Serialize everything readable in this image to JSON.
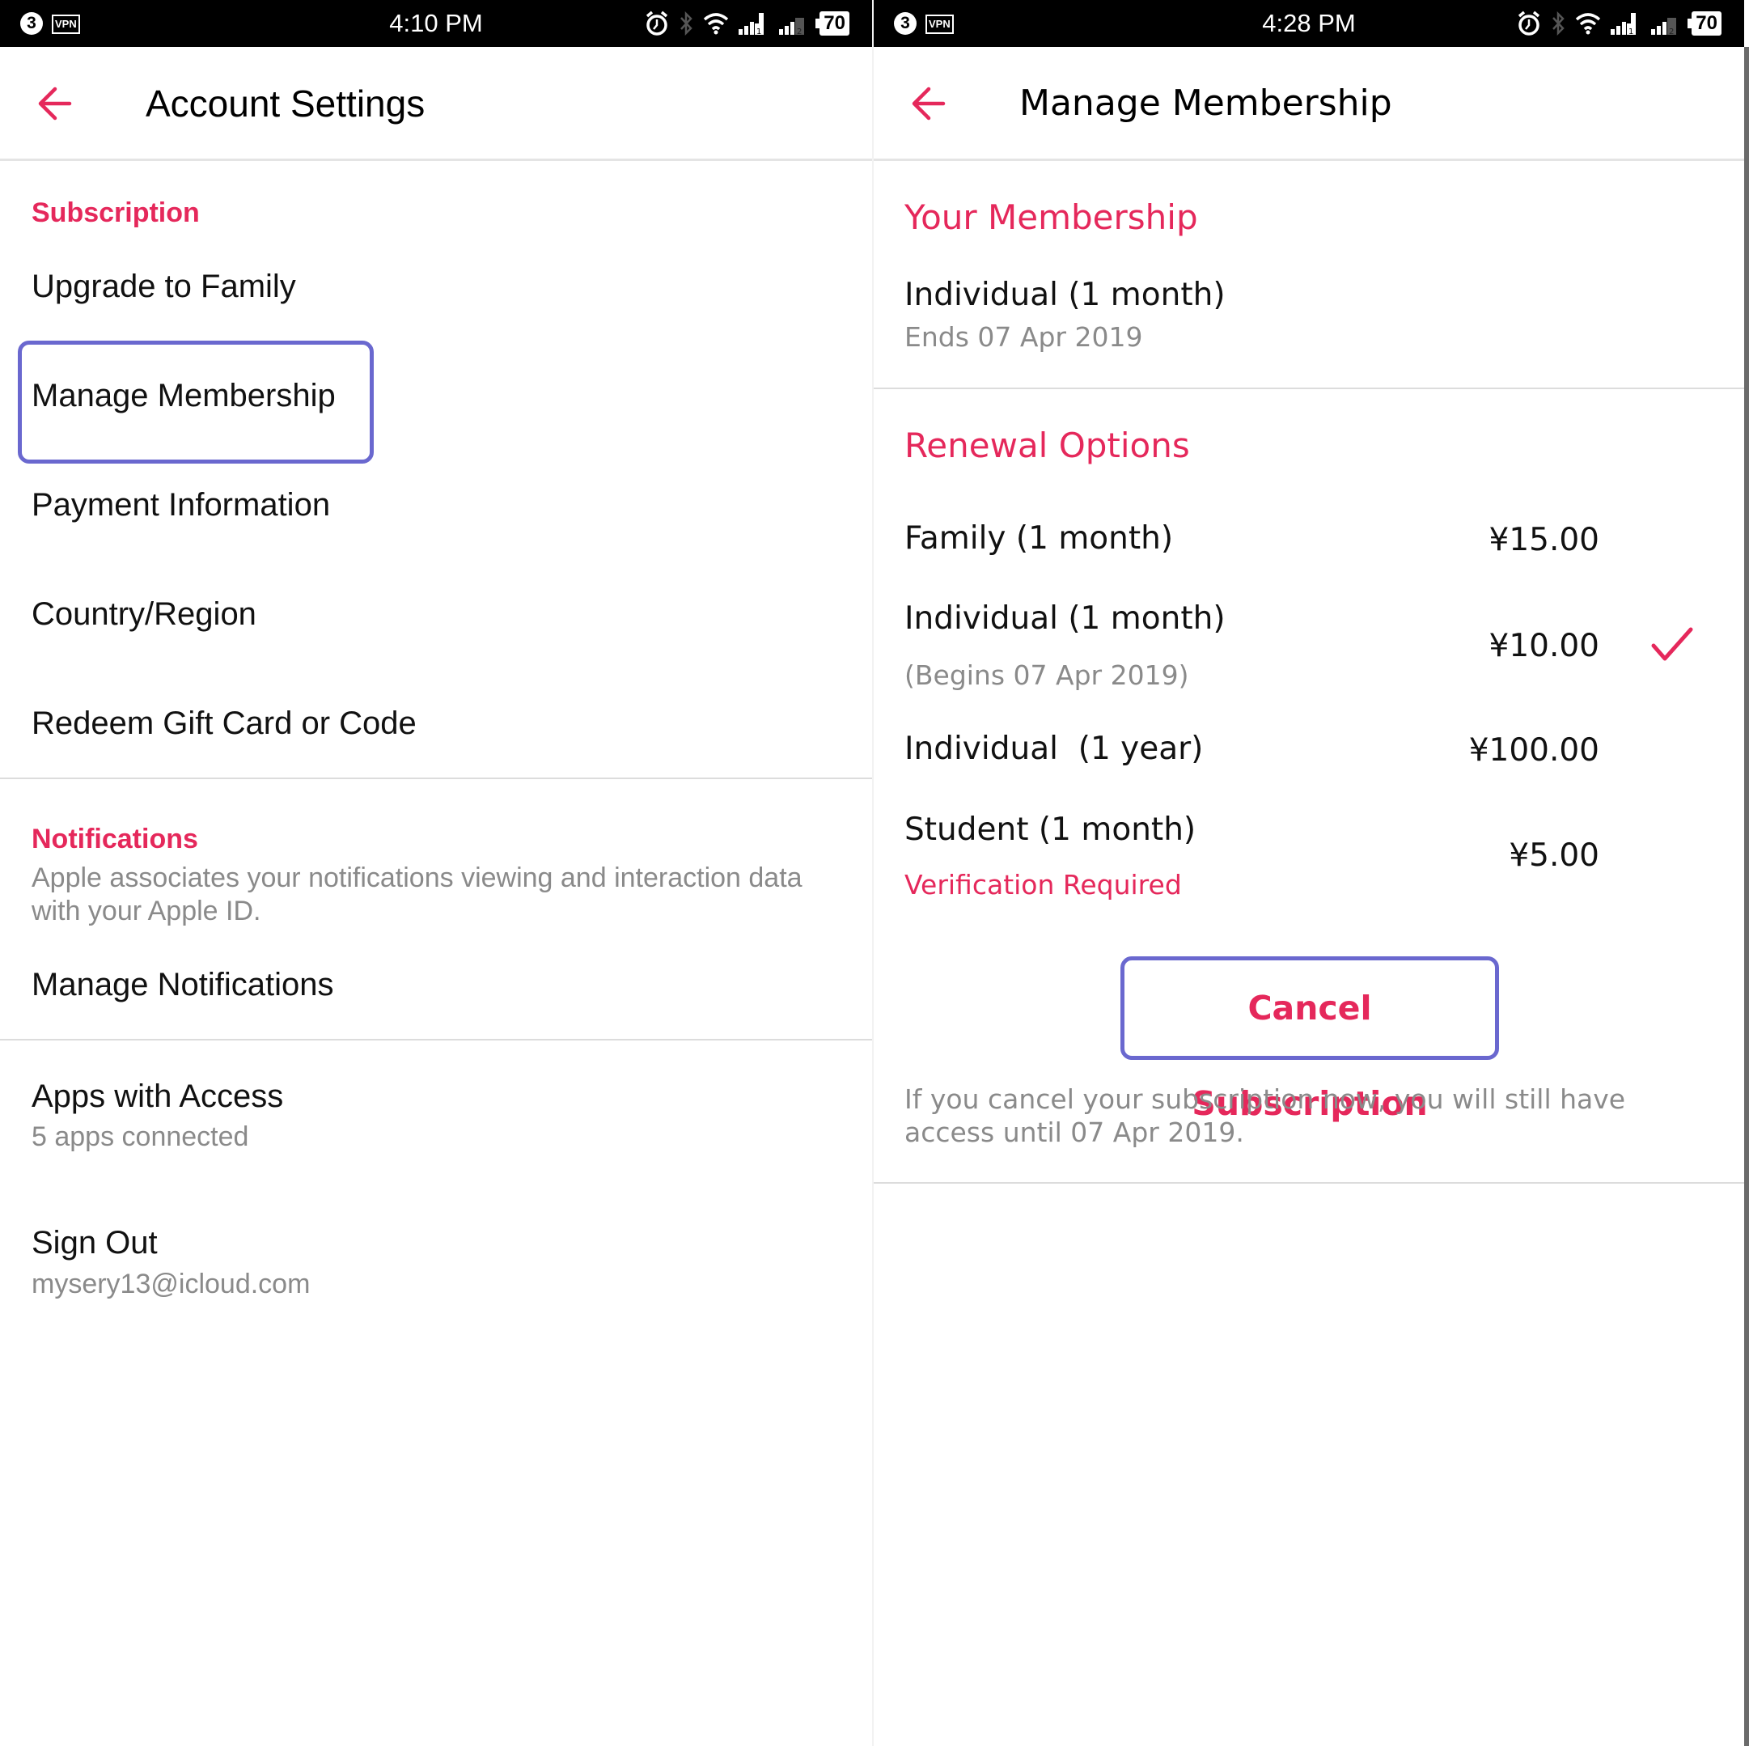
{
  "left_screen": {
    "status_bar": {
      "notification_count": "3",
      "vpn_label": "VPN",
      "time": "4:10 PM",
      "sim1_label": "1",
      "sim2_label": "2",
      "battery": "70"
    },
    "header": {
      "back_icon": "arrow-left-icon",
      "title": "Account Settings"
    },
    "subscription": {
      "heading": "Subscription",
      "items": [
        {
          "label": "Upgrade to Family"
        },
        {
          "label": "Manage Membership",
          "highlighted": true
        },
        {
          "label": "Payment Information"
        },
        {
          "label": "Country/Region"
        },
        {
          "label": "Redeem Gift Card or Code"
        }
      ]
    },
    "notifications": {
      "heading": "Notifications",
      "description_line1": "Apple associates your notifications viewing and interaction data",
      "description_line2": "with your Apple ID.",
      "manage_label": "Manage Notifications"
    },
    "apps_with_access": {
      "label": "Apps with Access",
      "subtitle": "5 apps connected"
    },
    "sign_out": {
      "label": "Sign Out",
      "email": "mysery13@icloud.com"
    }
  },
  "right_screen": {
    "status_bar": {
      "notification_count": "3",
      "vpn_label": "VPN",
      "time": "4:28 PM",
      "sim1_label": "1",
      "sim2_label": "2",
      "battery": "70"
    },
    "header": {
      "back_icon": "arrow-left-icon",
      "title": "Manage Membership"
    },
    "your_membership": {
      "heading": "Your Membership",
      "plan": "Individual (1 month)",
      "status": "Ends 07 Apr 2019"
    },
    "renewal_options": {
      "heading": "Renewal Options",
      "options": [
        {
          "name": "Family (1 month)",
          "price": "¥15.00",
          "note": "",
          "selected": false
        },
        {
          "name": "Individual (1 month)",
          "price": "¥10.00",
          "note": "(Begins 07 Apr 2019)",
          "selected": true
        },
        {
          "name": "Individual  (1 year)",
          "price": "¥100.00",
          "note": "",
          "selected": false
        },
        {
          "name": "Student (1 month)",
          "price": "¥5.00",
          "note": "Verification Required",
          "selected": false
        }
      ],
      "selected_icon": "checkmark-icon"
    },
    "cancel_button_label": "Cancel Subscription",
    "cancel_note": "If you cancel your subscription now, you will still have access until 07 Apr 2019."
  },
  "colors": {
    "accent": "#e5285b",
    "highlight_box": "#6a68cf",
    "secondary_text": "#8a8a8a",
    "status_bar_bg": "#000000"
  }
}
